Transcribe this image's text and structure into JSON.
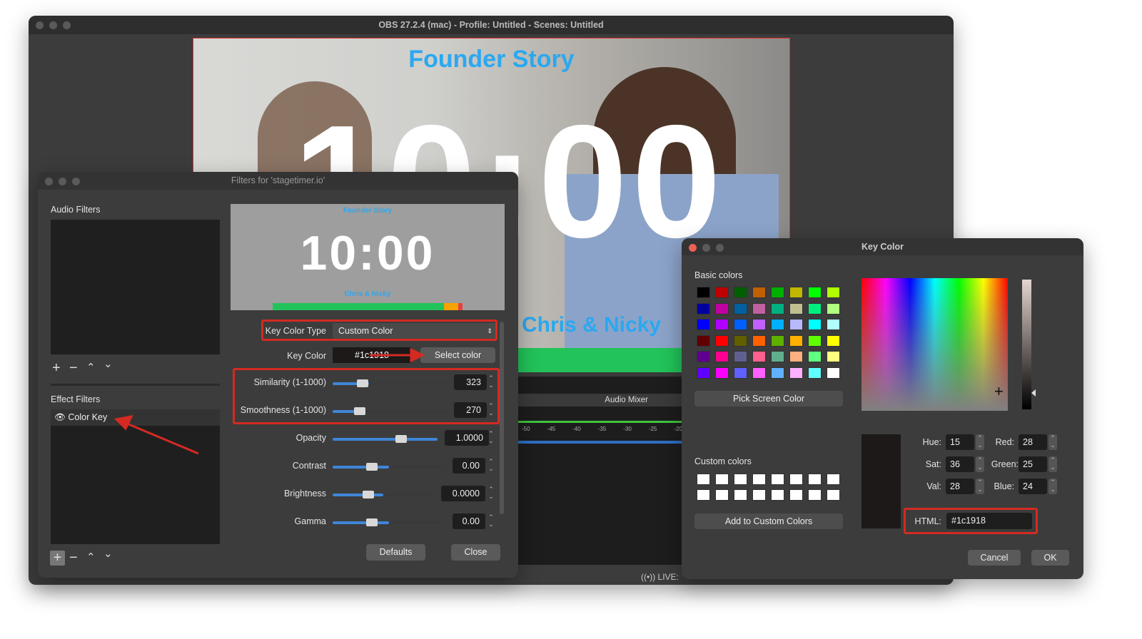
{
  "main_window": {
    "title": "OBS 27.2.4 (mac) - Profile: Untitled - Scenes: Untitled",
    "preview": {
      "title": "Founder Story",
      "timer": "10:00",
      "subtitle": "Chris & Nicky"
    },
    "audio_mixer": {
      "label": "Audio Mixer",
      "ticks": [
        "-50",
        "-45",
        "-40",
        "-35",
        "-30",
        "-25",
        "-20"
      ]
    },
    "status": {
      "live_label": "LIVE:"
    }
  },
  "filters_dialog": {
    "title": "Filters for 'stagetimer.io'",
    "audio_filters_label": "Audio Filters",
    "effect_filters_label": "Effect Filters",
    "effect_filters": [
      {
        "name": "Color Key",
        "visible": true
      }
    ],
    "preview": {
      "title": "Founder Story",
      "timer": "10:00",
      "subtitle": "Chris & Nicky"
    },
    "key_color_type": {
      "label": "Key Color Type",
      "value": "Custom Color"
    },
    "key_color": {
      "label": "Key Color",
      "value": "#1c1918",
      "select_label": "Select color"
    },
    "sliders": [
      {
        "label": "Similarity (1-1000)",
        "value": "323",
        "fraction": 0.32
      },
      {
        "label": "Smoothness (1-1000)",
        "value": "270",
        "fraction": 0.27
      },
      {
        "label": "Opacity",
        "value": "1.0000",
        "fraction": 1.0
      },
      {
        "label": "Contrast",
        "value": "0.00",
        "fraction": 0.5
      },
      {
        "label": "Brightness",
        "value": "0.0000",
        "fraction": 0.5
      },
      {
        "label": "Gamma",
        "value": "0.00",
        "fraction": 0.5
      }
    ],
    "defaults_label": "Defaults",
    "close_label": "Close"
  },
  "key_color_dialog": {
    "title": "Key Color",
    "basic_colors_label": "Basic colors",
    "basic_colors": [
      "#000000",
      "#c00000",
      "#006000",
      "#c06000",
      "#00b000",
      "#c0b800",
      "#00ff00",
      "#b0ff00",
      "#0000a0",
      "#c000a0",
      "#0060a0",
      "#c060a0",
      "#00b080",
      "#c0c090",
      "#00f080",
      "#b0ff80",
      "#0000ff",
      "#b000ff",
      "#0060ff",
      "#c060ff",
      "#00b0ff",
      "#b8b8ff",
      "#00ffff",
      "#b0ffff",
      "#600000",
      "#ff0000",
      "#606000",
      "#ff6000",
      "#60b000",
      "#ffb000",
      "#60ff00",
      "#ffff00",
      "#600090",
      "#ff0090",
      "#606090",
      "#ff6090",
      "#60b090",
      "#ffb080",
      "#60ff80",
      "#ffff80",
      "#6000ff",
      "#ff00ff",
      "#6060ff",
      "#ff60ff",
      "#60b0ff",
      "#ffb0ff",
      "#60ffff",
      "#ffffff"
    ],
    "pick_screen_label": "Pick Screen Color",
    "custom_colors_label": "Custom colors",
    "add_custom_label": "Add to Custom Colors",
    "hue": {
      "label": "Hue:",
      "value": "15"
    },
    "sat": {
      "label": "Sat:",
      "value": "36"
    },
    "val": {
      "label": "Val:",
      "value": "28"
    },
    "red": {
      "label": "Red:",
      "value": "28"
    },
    "green": {
      "label": "Green:",
      "value": "25"
    },
    "blue": {
      "label": "Blue:",
      "value": "24"
    },
    "html": {
      "label": "HTML:",
      "value": "#1c1918"
    },
    "current_color": "#1c1918",
    "cancel_label": "Cancel",
    "ok_label": "OK"
  },
  "colors": {
    "annotation": "#d42a22",
    "accent": "#3f86d8",
    "title_blue": "#2aa8f0"
  }
}
